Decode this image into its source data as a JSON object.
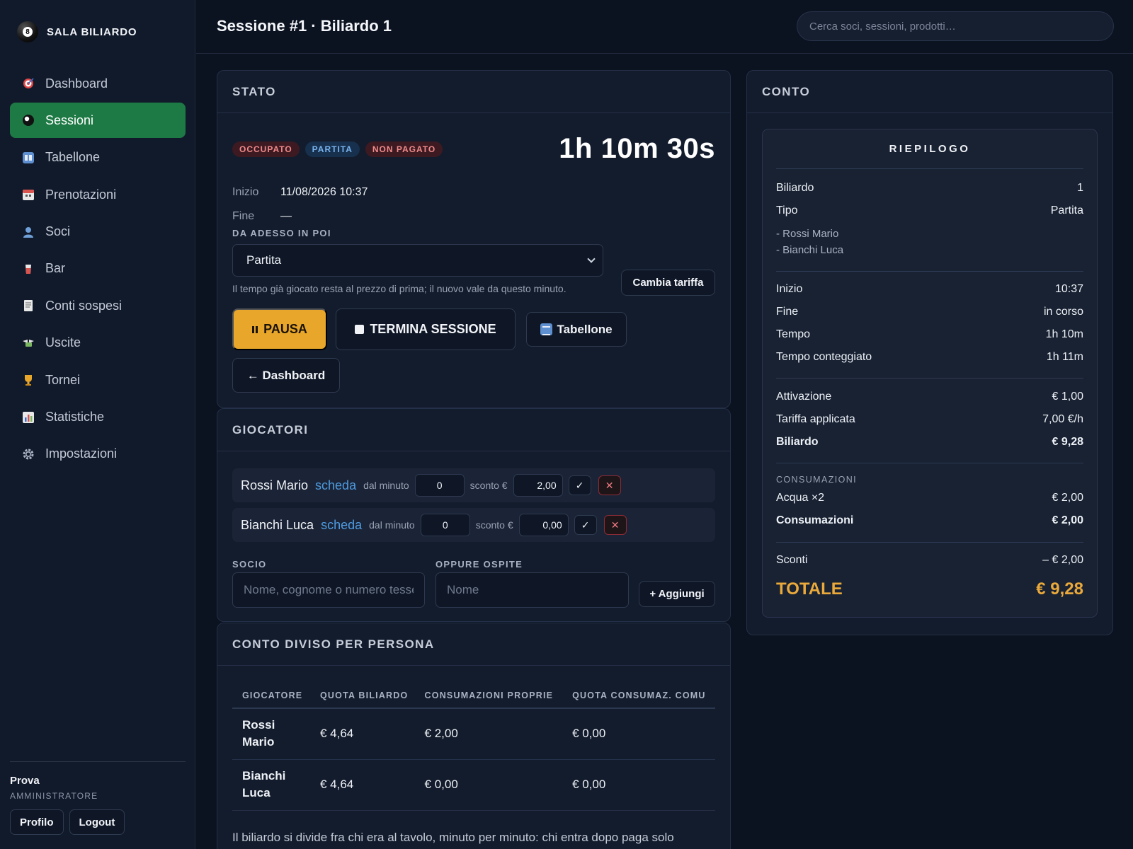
{
  "brand": {
    "name": "SALA BILIARDO",
    "ball_number": "8"
  },
  "nav": [
    {
      "label": "Dashboard",
      "icon": "dart-icon",
      "active": false
    },
    {
      "label": "Sessioni",
      "icon": "billiard-ball-icon",
      "active": true
    },
    {
      "label": "Tabellone",
      "icon": "scoreboard-icon",
      "active": false
    },
    {
      "label": "Prenotazioni",
      "icon": "calendar-icon",
      "active": false
    },
    {
      "label": "Soci",
      "icon": "user-icon",
      "active": false
    },
    {
      "label": "Bar",
      "icon": "drink-icon",
      "active": false
    },
    {
      "label": "Conti sospesi",
      "icon": "receipt-icon",
      "active": false
    },
    {
      "label": "Uscite",
      "icon": "money-wings-icon",
      "active": false
    },
    {
      "label": "Tornei",
      "icon": "trophy-icon",
      "active": false
    },
    {
      "label": "Statistiche",
      "icon": "bar-chart-icon",
      "active": false
    },
    {
      "label": "Impostazioni",
      "icon": "gear-icon",
      "active": false
    }
  ],
  "user": {
    "name": "Prova",
    "role": "AMMINISTRATORE",
    "profile_label": "Profilo",
    "logout_label": "Logout"
  },
  "header": {
    "title": "Sessione #1 · Biliardo 1",
    "search_placeholder": "Cerca soci, sessioni, prodotti…"
  },
  "stato": {
    "heading": "STATO",
    "badges": [
      {
        "label": "OCCUPATO",
        "color": "#f08a8a"
      },
      {
        "label": "PARTITA",
        "color": "#78b4f0"
      },
      {
        "label": "NON PAGATO",
        "color": "#f08a8a"
      }
    ],
    "timer": "1h 10m 30s",
    "inizio_label": "Inizio",
    "inizio_value": "11/08/2026 10:37",
    "fine_label": "Fine",
    "fine_value": "—",
    "rate_section_label": "DA ADESSO IN POI",
    "rate_selected": "Partita",
    "change_rate_label": "Cambia tariffa",
    "hint": "Il tempo già giocato resta al prezzo di prima; il nuovo vale da questo minuto.",
    "pause_label": "PAUSA",
    "end_label": "TERMINA SESSIONE",
    "scoreboard_label": "Tabellone",
    "back_label": "← Dashboard"
  },
  "giocatori": {
    "heading": "GIOCATORI",
    "players": [
      {
        "name": "Rossi Mario",
        "link": "scheda",
        "from_label": "dal minuto",
        "from_value": "0",
        "discount_label": "sconto €",
        "discount_value": "2,00"
      },
      {
        "name": "Bianchi Luca",
        "link": "scheda",
        "from_label": "dal minuto",
        "from_value": "0",
        "discount_label": "sconto €",
        "discount_value": "0,00"
      }
    ],
    "member_label": "SOCIO",
    "member_placeholder": "Nome, cognome o numero tessera",
    "guest_label": "OPPURE OSPITE",
    "guest_placeholder": "Nome",
    "add_label": "+ Aggiungi"
  },
  "split": {
    "heading": "CONTO DIVISO PER PERSONA",
    "columns": [
      "GIOCATORE",
      "QUOTA BILIARDO",
      "CONSUMAZIONI PROPRIE",
      "QUOTA CONSUMAZ. COMU"
    ],
    "rows": [
      {
        "name": "Rossi Mario",
        "quota": "€ 4,64",
        "proprie": "€ 2,00",
        "comuni": "€ 0,00"
      },
      {
        "name": "Bianchi Luca",
        "quota": "€ 4,64",
        "proprie": "€ 0,00",
        "comuni": "€ 0,00"
      }
    ],
    "note": "Il biliardo si divide fra chi era al tavolo, minuto per minuto: chi entra dopo paga solo"
  },
  "conto": {
    "heading": "CONTO",
    "summary_title": "RIEPILOGO",
    "biliardo_label": "Biliardo",
    "biliardo_value": "1",
    "tipo_label": "Tipo",
    "tipo_value": "Partita",
    "players": [
      "- Rossi Mario",
      "- Bianchi Luca"
    ],
    "inizio_label": "Inizio",
    "inizio_value": "10:37",
    "fine_label": "Fine",
    "fine_value": "in corso",
    "tempo_label": "Tempo",
    "tempo_value": "1h 10m",
    "conteggiato_label": "Tempo conteggiato",
    "conteggiato_value": "1h 11m",
    "attivazione_label": "Attivazione",
    "attivazione_value": "€ 1,00",
    "tariffa_label": "Tariffa applicata",
    "tariffa_value": "7,00 €/h",
    "biliardo_tot_label": "Biliardo",
    "biliardo_tot_value": "€ 9,28",
    "consumazioni_section": "CONSUMAZIONI",
    "items": [
      {
        "label": "Acqua ×2",
        "value": "€ 2,00"
      }
    ],
    "consumazioni_tot_label": "Consumazioni",
    "consumazioni_tot_value": "€ 2,00",
    "sconti_label": "Sconti",
    "sconti_value": "– € 2,00",
    "totale_label": "TOTALE",
    "totale_value": "€ 9,28"
  },
  "colors": {
    "accent_green": "#1d7a45",
    "warn": "#e8a72b",
    "total": "#eaa93a",
    "link": "#4f9be0"
  }
}
